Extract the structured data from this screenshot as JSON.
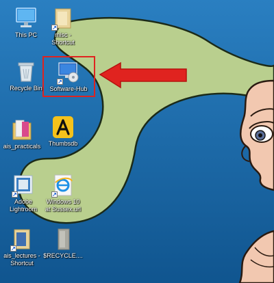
{
  "desktop": {
    "icons": [
      {
        "label": "This PC",
        "icon": "computer-icon"
      },
      {
        "label": "misc - Shortcut",
        "icon": "folder-shortcut-icon"
      },
      {
        "label": "Recycle Bin",
        "icon": "recycle-bin-icon"
      },
      {
        "label": "Software-Hub",
        "icon": "software-hub-icon"
      },
      {
        "label": "ais_practicals",
        "icon": "folder-icon"
      },
      {
        "label": "Thumbsdb",
        "icon": "thumbsdb-icon"
      },
      {
        "label": "Adobe Lightroom",
        "icon": "lightroom-icon"
      },
      {
        "label": "Windows 10 at Sussex.url",
        "icon": "internet-explorer-icon"
      },
      {
        "label": "ais_lectures - Shortcut",
        "icon": "folder-shortcut-icon"
      },
      {
        "label": "$RECYCLE....",
        "icon": "folder-icon"
      }
    ]
  },
  "annotation": {
    "highlight_color": "#e0231f",
    "arrow_color": "#e0231f",
    "target": "Software-Hub"
  },
  "colors": {
    "desktop_background": "#1a6fb0",
    "wallpaper_figure": "#b9cf8e"
  }
}
